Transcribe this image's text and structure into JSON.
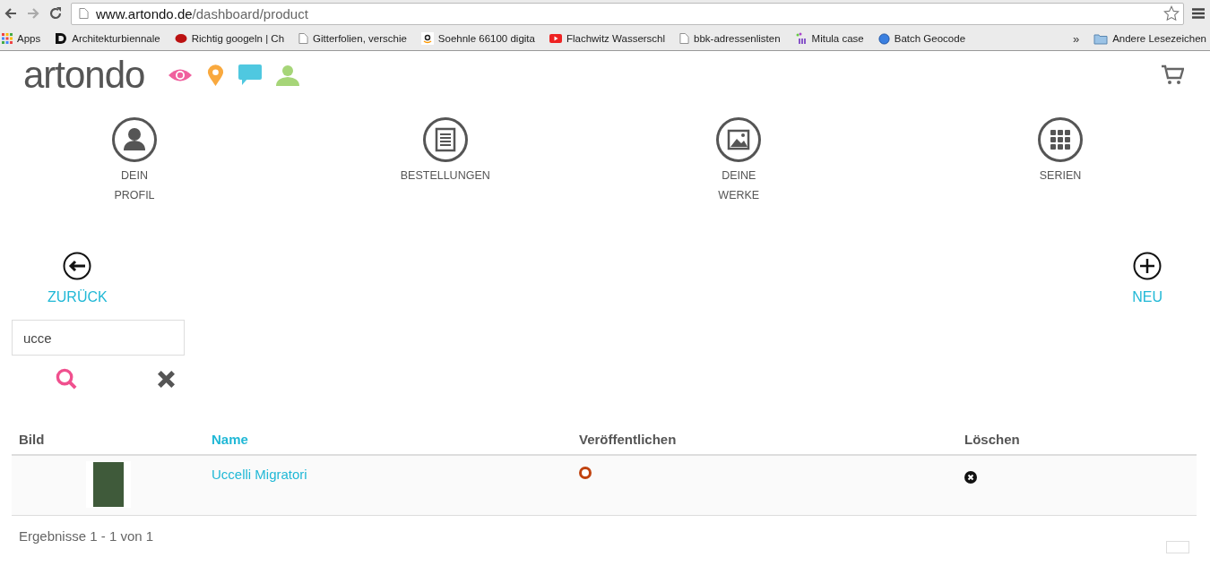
{
  "browser": {
    "url_host": "www.artondo.de",
    "url_path": "/dashboard/product",
    "bookmarks": [
      {
        "kind": "apps",
        "label": "Apps"
      },
      {
        "kind": "letter",
        "label": "Architekturbiennale"
      },
      {
        "kind": "red",
        "label": "Richtig googeln | Ch"
      },
      {
        "kind": "page",
        "label": "Gitterfolien, verschie"
      },
      {
        "kind": "amazon",
        "label": "Soehnle 66100 digita"
      },
      {
        "kind": "video",
        "label": "Flachwitz Wasserschl"
      },
      {
        "kind": "page",
        "label": "bbk-adressenlisten"
      },
      {
        "kind": "m",
        "label": "Mitula case"
      },
      {
        "kind": "globe",
        "label": "Batch Geocode"
      }
    ],
    "overflow": "»",
    "other_bookmarks": "Andere Lesezeichen"
  },
  "site": {
    "logo": "artondo"
  },
  "nav": [
    {
      "kind": "profile",
      "lines": [
        "DEIN",
        "PROFIL"
      ]
    },
    {
      "kind": "orders",
      "lines": [
        "BESTELLUNGEN"
      ]
    },
    {
      "kind": "works",
      "lines": [
        "DEINE",
        "WERKE"
      ]
    },
    {
      "kind": "series",
      "lines": [
        "SERIEN"
      ]
    }
  ],
  "actions": {
    "back": "ZURÜCK",
    "new": "NEU"
  },
  "search": {
    "value": "ucce"
  },
  "table": {
    "columns": [
      {
        "label": "Bild",
        "sorted": false
      },
      {
        "label": "Name",
        "sorted": true
      },
      {
        "label": "Veröffentlichen",
        "sorted": false
      },
      {
        "label": "Löschen",
        "sorted": false
      }
    ],
    "rows": [
      {
        "name": "Uccelli Migratori",
        "published": true
      }
    ]
  },
  "results": "Ergebnisse 1 - 1 von 1"
}
